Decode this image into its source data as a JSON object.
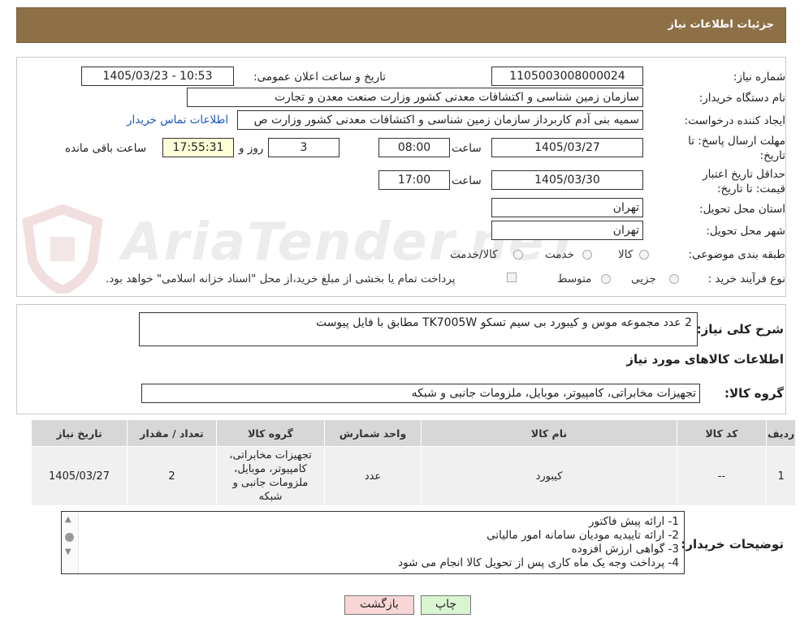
{
  "header": {
    "title": "جزئیات اطلاعات نیاز"
  },
  "watermark": "AriaTender.neT",
  "form": {
    "need_number": {
      "label": "شماره نیاز:",
      "value": "1105003008000024"
    },
    "announce": {
      "label": "تاریخ و ساعت اعلان عمومی:",
      "value": "1405/03/23 - 10:53"
    },
    "buyer": {
      "label": "نام دستگاه خریدار:",
      "value": "سازمان زمین شناسی و اکتشافات معدنی کشور وزارت صنعت معدن و تجارت"
    },
    "creator": {
      "label": "ایجاد کننده درخواست:",
      "value": "سمیه بنی آدم کاربرداز سازمان زمین شناسی و اکتشافات معدنی کشور وزارت ص",
      "contact_link": "اطلاعات تماس خریدار"
    },
    "deadline": {
      "label": "مهلت ارسال پاسخ: تا تاریخ:",
      "date": "1405/03/27",
      "time_label": "ساعت",
      "time": "08:00",
      "days": "3",
      "days_label": "روز و",
      "remaining": "17:55:31",
      "remaining_label": "ساعت باقی مانده"
    },
    "validity": {
      "label": "حداقل تاریخ اعتبار قیمت: تا تاریخ:",
      "date": "1405/03/30",
      "time_label": "ساعت",
      "time": "17:00"
    },
    "province": {
      "label": "استان محل تحویل:",
      "value": "تهران"
    },
    "city": {
      "label": "شهر محل تحویل:",
      "value": "تهران"
    },
    "category": {
      "label": "طبقه بندی موضوعی:",
      "options": [
        "کالا",
        "خدمت",
        "کالا/خدمت"
      ]
    },
    "process": {
      "label": "نوع فرآیند خرید :",
      "options": [
        "جزیی",
        "متوسط"
      ],
      "payment_note": "پرداخت تمام یا بخشی از مبلغ خرید،از محل \"اسناد خزانه اسلامی\" خواهد بود."
    }
  },
  "description": {
    "label": "شرح کلی نیاز:",
    "value": "2 عدد  مجموعه موس و کیبورد بی سیم تسکو TK7005W مطابق با فایل پیوست"
  },
  "goods_info_title": "اطلاعات کالاهای مورد نیاز",
  "goods_group": {
    "label": "گروه کالا:",
    "value": "تجهیزات مخابراتی، کامپیوتر، موبایل، ملزومات جانبی و شبکه"
  },
  "table": {
    "headers": [
      "ردیف",
      "کد کالا",
      "نام کالا",
      "واحد شمارش",
      "گروه کالا",
      "تعداد / مقدار",
      "تاریخ نیاز"
    ],
    "rows": [
      {
        "row": "1",
        "code": "--",
        "name": "کیبورد",
        "unit": "عدد",
        "group": "تجهیزات مخابراتی، کامپیوتر، موبایل، ملزومات جانبی و شبکه",
        "qty": "2",
        "date": "1405/03/27"
      }
    ]
  },
  "buyer_notes": {
    "label": "توضیحات خریدار:",
    "lines": [
      "1-    ارائه پیش فاکتور",
      "2-    ارائه تاییدیه مودیان سامانه امور مالیاتی",
      "3-    گواهی ارزش افزوده",
      "4-    پرداخت وجه یک ماه کاری پس از تحویل کالا انجام می شود"
    ]
  },
  "buttons": {
    "print": "چاپ",
    "back": "بازگشت"
  },
  "colors": {
    "header": "#8e7047",
    "back_button": "#f9d6d6",
    "print_button": "#d9f5d0",
    "link": "#1a57c4"
  }
}
